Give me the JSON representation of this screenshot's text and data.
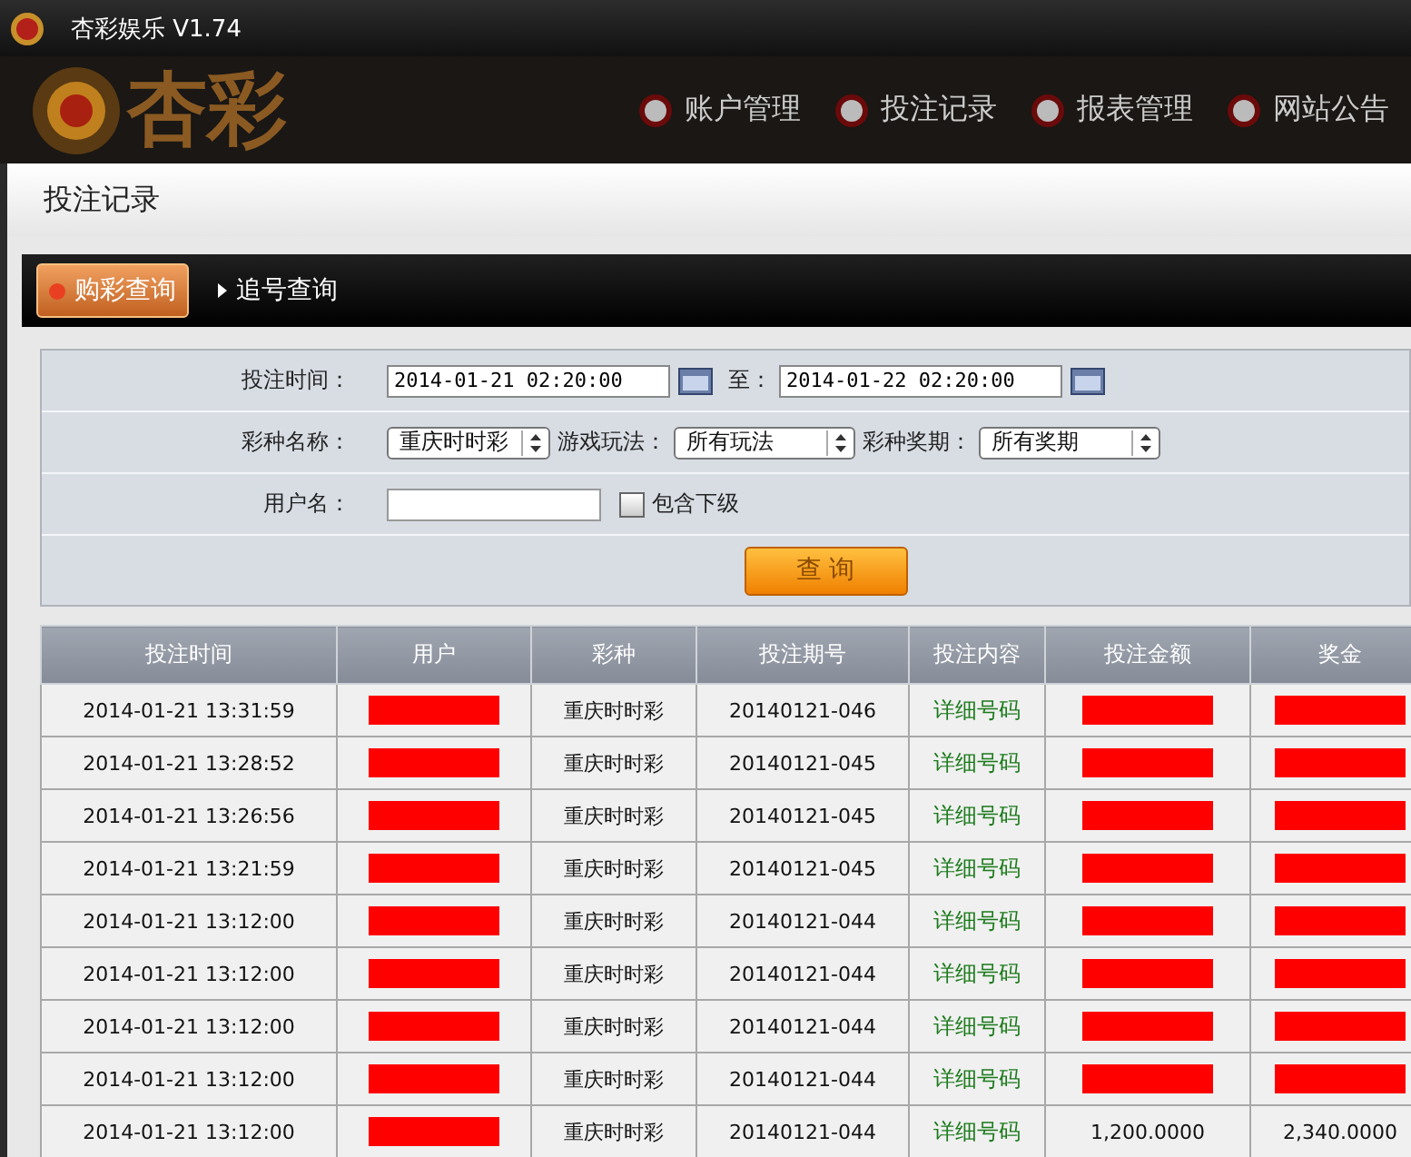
{
  "window": {
    "title": "杏彩娱乐 V1.74"
  },
  "logo": {
    "text": "杏彩"
  },
  "nav": [
    {
      "label": "账户管理"
    },
    {
      "label": "投注记录"
    },
    {
      "label": "报表管理"
    },
    {
      "label": "网站公告"
    }
  ],
  "page_title": "投注记录",
  "tabs": [
    {
      "label": "购彩查询",
      "selected": true
    },
    {
      "label": "追号查询",
      "selected": false
    }
  ],
  "filters": {
    "time_label": "投注时间：",
    "start": "2014-01-21 02:20:00",
    "to_label": "至：",
    "end": "2014-01-22 02:20:00",
    "lottery_label": "彩种名称：",
    "lottery": "重庆时时彩",
    "play_label": "游戏玩法：",
    "play": "所有玩法",
    "period_label": "彩种奖期：",
    "period": "所有奖期",
    "user_label": "用户名：",
    "include_sub": {
      "label": "包含下级",
      "checked": false
    },
    "query_button": "查 询"
  },
  "table": {
    "columns": [
      "投注时间",
      "用户",
      "彩种",
      "投注期号",
      "投注内容",
      "投注金额",
      "奖金"
    ],
    "rows": [
      {
        "cells": [
          {
            "kind": "text",
            "text": "2014-01-21 13:31:59"
          },
          {
            "kind": "redacted"
          },
          {
            "kind": "text",
            "text": "重庆时时彩"
          },
          {
            "kind": "text",
            "text": "20140121-046"
          },
          {
            "kind": "link",
            "text": "详细号码"
          },
          {
            "kind": "redacted"
          },
          {
            "kind": "redacted"
          }
        ]
      },
      {
        "cells": [
          {
            "kind": "text",
            "text": "2014-01-21 13:28:52"
          },
          {
            "kind": "redacted"
          },
          {
            "kind": "text",
            "text": "重庆时时彩"
          },
          {
            "kind": "text",
            "text": "20140121-045"
          },
          {
            "kind": "link",
            "text": "详细号码"
          },
          {
            "kind": "redacted"
          },
          {
            "kind": "redacted"
          }
        ]
      },
      {
        "cells": [
          {
            "kind": "text",
            "text": "2014-01-21 13:26:56"
          },
          {
            "kind": "redacted"
          },
          {
            "kind": "text",
            "text": "重庆时时彩"
          },
          {
            "kind": "text",
            "text": "20140121-045"
          },
          {
            "kind": "link",
            "text": "详细号码"
          },
          {
            "kind": "redacted"
          },
          {
            "kind": "redacted"
          }
        ]
      },
      {
        "cells": [
          {
            "kind": "text",
            "text": "2014-01-21 13:21:59"
          },
          {
            "kind": "redacted"
          },
          {
            "kind": "text",
            "text": "重庆时时彩"
          },
          {
            "kind": "text",
            "text": "20140121-045"
          },
          {
            "kind": "link",
            "text": "详细号码"
          },
          {
            "kind": "redacted"
          },
          {
            "kind": "redacted"
          }
        ]
      },
      {
        "cells": [
          {
            "kind": "text",
            "text": "2014-01-21 13:12:00"
          },
          {
            "kind": "redacted"
          },
          {
            "kind": "text",
            "text": "重庆时时彩"
          },
          {
            "kind": "text",
            "text": "20140121-044"
          },
          {
            "kind": "link",
            "text": "详细号码"
          },
          {
            "kind": "redacted"
          },
          {
            "kind": "redacted"
          }
        ]
      },
      {
        "cells": [
          {
            "kind": "text",
            "text": "2014-01-21 13:12:00"
          },
          {
            "kind": "redacted"
          },
          {
            "kind": "text",
            "text": "重庆时时彩"
          },
          {
            "kind": "text",
            "text": "20140121-044"
          },
          {
            "kind": "link",
            "text": "详细号码"
          },
          {
            "kind": "redacted"
          },
          {
            "kind": "redacted"
          }
        ]
      },
      {
        "cells": [
          {
            "kind": "text",
            "text": "2014-01-21 13:12:00"
          },
          {
            "kind": "redacted"
          },
          {
            "kind": "text",
            "text": "重庆时时彩"
          },
          {
            "kind": "text",
            "text": "20140121-044"
          },
          {
            "kind": "link",
            "text": "详细号码"
          },
          {
            "kind": "redacted"
          },
          {
            "kind": "redacted"
          }
        ]
      },
      {
        "cells": [
          {
            "kind": "text",
            "text": "2014-01-21 13:12:00"
          },
          {
            "kind": "redacted"
          },
          {
            "kind": "text",
            "text": "重庆时时彩"
          },
          {
            "kind": "text",
            "text": "20140121-044"
          },
          {
            "kind": "link",
            "text": "详细号码"
          },
          {
            "kind": "redacted"
          },
          {
            "kind": "redacted"
          }
        ]
      },
      {
        "cells": [
          {
            "kind": "text",
            "text": "2014-01-21 13:12:00"
          },
          {
            "kind": "redacted"
          },
          {
            "kind": "text",
            "text": "重庆时时彩"
          },
          {
            "kind": "text",
            "text": "20140121-044"
          },
          {
            "kind": "link",
            "text": "详细号码"
          },
          {
            "kind": "text",
            "text": "1,200.0000"
          },
          {
            "kind": "text",
            "text": "2,340.0000"
          }
        ]
      }
    ]
  }
}
